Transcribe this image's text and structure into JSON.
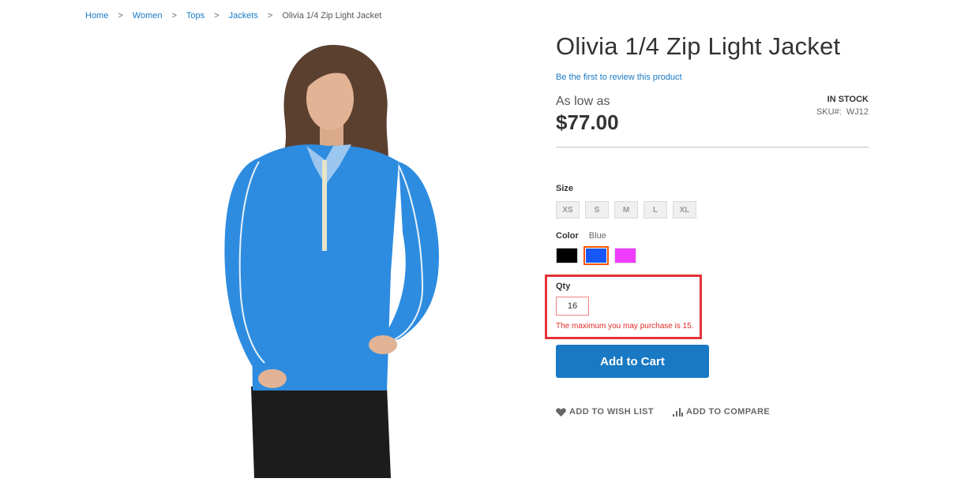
{
  "breadcrumb": {
    "items": [
      "Home",
      "Women",
      "Tops",
      "Jackets"
    ],
    "current": "Olivia 1/4 Zip Light Jacket",
    "separator": ">"
  },
  "product": {
    "title": "Olivia 1/4 Zip Light Jacket",
    "review_link": "Be the first to review this product",
    "price_label": "As low as",
    "price": "$77.00",
    "stock": "IN STOCK",
    "sku_label": "SKU#:",
    "sku": "WJ12",
    "image_alt": "Woman wearing blue Olivia 1/4 zip light jacket"
  },
  "options": {
    "size_label": "Size",
    "sizes": [
      "XS",
      "S",
      "M",
      "L",
      "XL"
    ],
    "color_label": "Color",
    "selected_color": "Blue",
    "colors": [
      {
        "name": "Black",
        "hex": "#000000",
        "selected": false
      },
      {
        "name": "Blue",
        "hex": "#1857f7",
        "selected": true
      },
      {
        "name": "Purple",
        "hex": "#ef3dff",
        "selected": false
      }
    ]
  },
  "qty": {
    "label": "Qty",
    "value": "16",
    "error": "The maximum you may purchase is 15."
  },
  "buttons": {
    "add_to_cart": "Add to Cart",
    "wish_list": "ADD TO WISH LIST",
    "compare": "ADD TO COMPARE"
  },
  "colors": {
    "accent": "#1979c3",
    "error": "#e02b27",
    "highlight": "#e53238"
  }
}
